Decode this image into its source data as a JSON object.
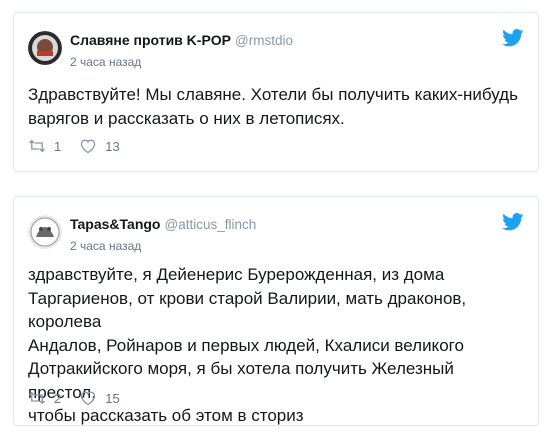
{
  "tweets": [
    {
      "name": "Славяне против K-POP",
      "handle": "@rmstdio",
      "time": "2 часа назад",
      "text": "Здравствуйте! Мы славяне. Хотели бы получить каких-нибудь\nварягов и рассказать о них в летописях.",
      "retweets": "1",
      "likes": "13"
    },
    {
      "name": "Tapas&Tango",
      "handle": "@atticus_flinch",
      "time": "2 часа назад",
      "text": "здравствуйте, я Дейенерис Бурерожденная, из дома\nТаргариенов, от крови старой Валирии, мать драконов, королева\nАндалов, Ройнаров и первых людей, Кхалиси великого\nДотракийского моря, я бы хотела получить Железный престол,\nчтобы рассказать об этом в сториз",
      "retweets": "2",
      "likes": "15"
    }
  ],
  "colors": {
    "brand": "#1da1f2",
    "text": "#14171a",
    "muted": "#657786",
    "border": "#e1e8ed"
  },
  "icons": [
    "avatar",
    "twitter-bird-icon",
    "retweet-icon",
    "heart-icon"
  ]
}
